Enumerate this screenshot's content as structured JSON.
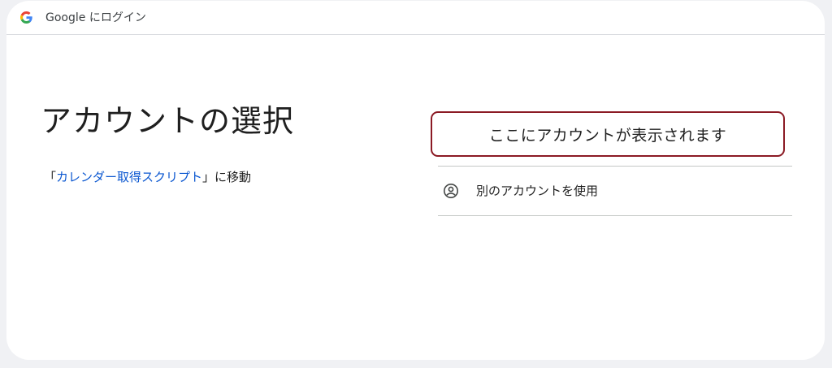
{
  "topbar": {
    "title": "Google にログイン",
    "logo_icon": "google-g-icon"
  },
  "main": {
    "heading": "アカウントの選択",
    "continue_prefix": "「",
    "app_name": "カレンダー取得スクリプト",
    "continue_suffix": "」に移動"
  },
  "accounts": {
    "placeholder_text": "ここにアカウントが表示されます",
    "use_another_label": "別のアカウントを使用",
    "use_another_icon": "person-circle-icon"
  },
  "colors": {
    "link": "#0b57d0",
    "highlight_border": "#8b1a24",
    "divider": "#c4c7c5",
    "text": "#1f1f1f"
  }
}
